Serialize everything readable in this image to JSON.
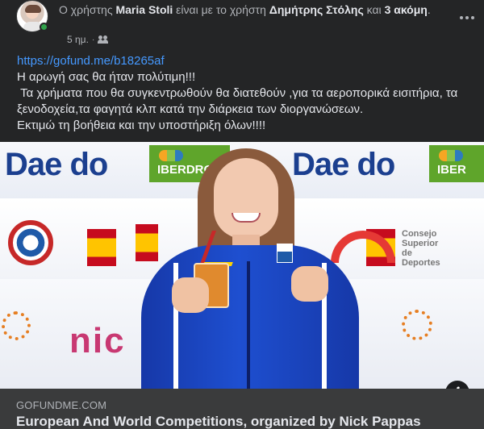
{
  "post": {
    "author_prefix": "Ο χρήστης",
    "author_name": "Maria Stoli",
    "with_text": "είναι με το χρήστη",
    "tagged_name": "Δημήτρης Στόλης",
    "and_text": "και",
    "others_text": "3 ακόμη",
    "timestamp": "5 ημ.",
    "separator": "·",
    "audience_icon": "friends-icon",
    "more_icon": "more-dots-icon"
  },
  "body": {
    "link": "https://gofund.me/b18265af",
    "lines": [
      "Η αρωγή σας θα ήταν πολύτιμη!!!",
      " Τα χρήματα που θα συγκεντρωθούν θα διατεθούν ,για τα αεροπορικά εισιτήρια, τα ξενοδοχεία,τα φαγητά κλπ κατά την διάρκεια των διοργανώσεων.",
      "Εκτιμώ τη βοήθεια και την υποστήριξη όλων!!!!"
    ]
  },
  "photo": {
    "banner_brand": "Dae do",
    "sponsor": "IBERDROLA",
    "sponsor_partial": "IBER",
    "sign_text": "Consejo Superior de Deportes",
    "info_icon": "info-icon",
    "info_glyph": "i"
  },
  "preview": {
    "domain": "GOFUNDME.COM",
    "title": "European And World Competitions, organized by Nick Pappas"
  }
}
